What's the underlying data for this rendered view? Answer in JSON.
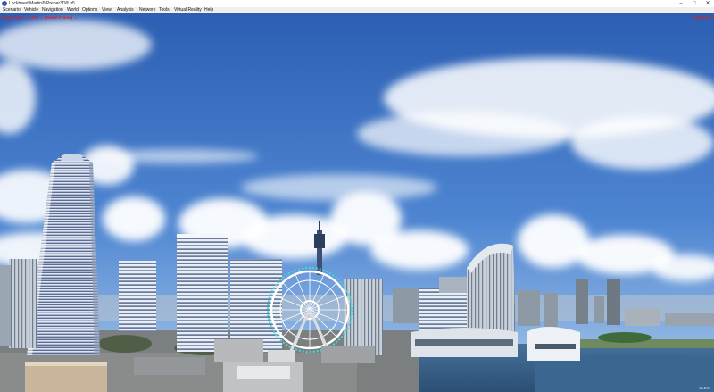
{
  "window": {
    "title": "Lockheed Martin® Prepar3D® v5",
    "minimize": "–",
    "maximize": "□",
    "close": "✕"
  },
  "menu": {
    "items": [
      "Scenario",
      "Vehicle",
      "Navigation",
      "World",
      "Options",
      "View",
      "Analysis",
      "Network",
      "Tools",
      "Virtual Reality",
      "Help"
    ]
  },
  "hud": {
    "status": "Frame Rate ... Limit ... (Health Frame) ...",
    "sound": "Sound Off",
    "direction": "SLEW"
  },
  "colors": {
    "sky_top": "#2f63b6",
    "sky_bottom": "#9fc3e8",
    "status_red": "#e02020",
    "ferris_wheel_lights": "#41d6e0"
  }
}
